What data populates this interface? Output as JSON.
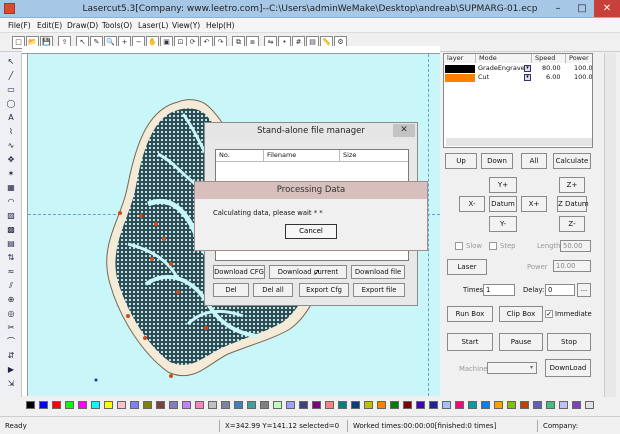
{
  "window": {
    "title": "Lasercut5.3[Company: www.leetro.com]--C:\\Users\\adminWeMake\\Desktop\\andreab\\SUPMARG-01.ecp",
    "min": "–",
    "max": "□",
    "close": "✕"
  },
  "menu": [
    "File(F)",
    "Edit(E)",
    "Draw(D)",
    "Tools(O)",
    "Laser(L)",
    "View(Y)",
    "Help(H)"
  ],
  "toolbar_icons": [
    "new-icon",
    "open-icon",
    "save-icon",
    "import-icon",
    "pick-icon",
    "node-edit-icon",
    "zoom-icon",
    "zoom-in-icon",
    "zoom-out-icon",
    "pan-icon",
    "zoom-page-icon",
    "zoom-all-icon",
    "refresh-icon",
    "undo-icon",
    "redo-icon",
    "group-icon",
    "ungroup-icon",
    "mirror-icon",
    "node-icon",
    "array-icon",
    "preview-icon",
    "measure-icon",
    "settings-icon"
  ],
  "toolbar_glyphs": [
    "□",
    "📂",
    "💾",
    "⇪",
    "↖",
    "✎",
    "🔍",
    "+",
    "−",
    "✋",
    "▣",
    "⊡",
    "⟳",
    "↶",
    "↷",
    "⧉",
    "⧈",
    "⇋",
    "•",
    "#",
    "▤",
    "📏",
    "⚙"
  ],
  "left_tools": [
    "pointer",
    "line",
    "rectangle",
    "ellipse",
    "text",
    "polyline",
    "bezier",
    "node",
    "star",
    "grid",
    "arc",
    "scan",
    "fill",
    "hatch",
    "sort",
    "wave",
    "split",
    "join",
    "offset",
    "cut",
    "path",
    "order",
    "simulate",
    "output"
  ],
  "left_glyphs": [
    "↖",
    "╱",
    "▭",
    "◯",
    "A",
    "⌇",
    "∿",
    "✥",
    "✶",
    "▦",
    "◠",
    "▨",
    "▩",
    "▤",
    "⇅",
    "≈",
    "⫽",
    "⊕",
    "◎",
    "✂",
    "⌒",
    "⇵",
    "▶",
    "⇲"
  ],
  "layers": {
    "headers": [
      "layer",
      "Mode",
      "Speed",
      "Power"
    ],
    "rows": [
      {
        "color": "#000000",
        "mode": "GradeEngrave",
        "speed": "80.00",
        "power": "100.00"
      },
      {
        "color": "#ff8000",
        "mode": "Cut",
        "speed": "6.00",
        "power": "100.00"
      }
    ]
  },
  "controls": {
    "up": "Up",
    "down": "Down",
    "all": "All",
    "calculate": "Calculate",
    "yplus": "Y+",
    "xminus": "X-",
    "datum": "Datum",
    "xplus": "X+",
    "yminus": "Y-",
    "zplus": "Z+",
    "zdatum": "Z Datum",
    "zminus": "Z-",
    "slow": "Slow",
    "step": "Step",
    "length_label": "Length",
    "length_value": "50.00",
    "laser": "Laser",
    "power_label": "Power",
    "power_value": "10.00",
    "times_label": "Times:",
    "times_value": "1",
    "delay_label": "Delay:",
    "delay_value": "0",
    "delay_btn": "...",
    "run_box": "Run Box",
    "clip_box": "Clip Box",
    "immediate": "Immediate",
    "start": "Start",
    "pause": "Pause",
    "stop": "Stop",
    "machine_label": "Machine",
    "download": "DownLoad"
  },
  "file_manager": {
    "title": "Stand-alone file manager",
    "close": "✕",
    "columns": [
      "No.",
      "Filename",
      "Size"
    ],
    "buttons_row1": [
      "Download CFG",
      "Download current",
      "Download file"
    ],
    "buttons_row2": [
      "Del",
      "Del all",
      "Export Cfg",
      "Export file"
    ]
  },
  "processing": {
    "title": "Processing Data",
    "message": "Calculating data, please wait * * ",
    "cancel": "Cancel"
  },
  "palette": [
    "#000000",
    "#0000ff",
    "#ff0000",
    "#00ff00",
    "#ff00ff",
    "#00ffff",
    "#ffff00",
    "#ffc0cb",
    "#8080ff",
    "#808000",
    "#804040",
    "#8080c0",
    "#c080ff",
    "#ff80c0",
    "#c0c0c0",
    "#8080a0",
    "#4080c0",
    "#40a0a0",
    "#808080",
    "#c0ffc0",
    "#a0a0ff",
    "#404080",
    "#800080",
    "#ff8080",
    "#008080",
    "#004080",
    "#c0c000",
    "#ff8000",
    "#008000",
    "#800000",
    "#4000c0",
    "#2020a0",
    "#a0c0ff",
    "#ff0080",
    "#00a0a0",
    "#0080ff",
    "#ffa000",
    "#80c000",
    "#c04000",
    "#6060c0",
    "#40c080",
    "#c0c0ff",
    "#8040c0",
    "#e0e0e0"
  ],
  "status": {
    "ready": "Ready",
    "coords": "X=342.99 Y=141.12 selected=0",
    "worked": "Worked times:00:00:00[finished:0 times]",
    "company": "Company:"
  }
}
